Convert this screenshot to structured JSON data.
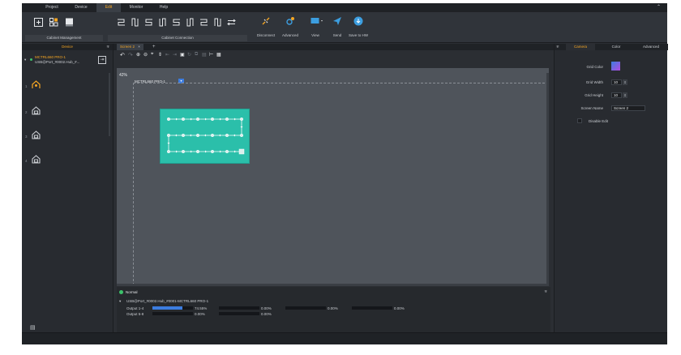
{
  "menu": {
    "items": [
      {
        "label": "Project"
      },
      {
        "label": "Device"
      },
      {
        "label": "Edit"
      },
      {
        "label": "Monitor"
      },
      {
        "label": "Help"
      }
    ]
  },
  "toolbar": {
    "group1_label": "Cabinet Management",
    "group2_label": "Cabinet Connection",
    "disconnect_label": "Disconnect",
    "advanced_label": "Advanced",
    "view_label": "View",
    "send_label": "Send",
    "save_label": "Save to HW"
  },
  "left_panel": {
    "title": "Device",
    "device_name": "MCTRL660 PRO-1",
    "device_port": "USB@Port_#0002.Hub_#..."
  },
  "center": {
    "tab_label": "Screen 2",
    "zoom": "42%",
    "controller_label": "MCTRL660 PRO-1"
  },
  "status": {
    "state": "Normal",
    "path": "USB@Port_#0002.Hub_#0001-MCTRL660 PRO-1",
    "outputs": [
      {
        "label": "Output 1-4",
        "values": [
          "74.55%",
          "0.00%",
          "0.00%",
          "0.00%"
        ],
        "fills": [
          0.7455,
          0,
          0,
          0
        ]
      },
      {
        "label": "Output 5-8",
        "values": [
          "0.00%",
          "0.00%"
        ],
        "fills": [
          0,
          0
        ]
      }
    ]
  },
  "right_panel": {
    "tabs": [
      {
        "label": "Camera"
      },
      {
        "label": "Color"
      },
      {
        "label": "Advanced"
      }
    ],
    "grid_color_label": "Grid Color",
    "grid_width_label": "Grid Width",
    "grid_width_value": "10",
    "grid_height_label": "Grid Height",
    "grid_height_value": "10",
    "screen_name_label": "Screen Name",
    "screen_name_value": "Screen 2",
    "disable_edit_label": "Disable Edit"
  },
  "colors": {
    "accent": "#f5a623",
    "grid_teal": "#2bbfaa",
    "progress_blue": "#3c7de0",
    "status_green": "#3cc26a"
  }
}
